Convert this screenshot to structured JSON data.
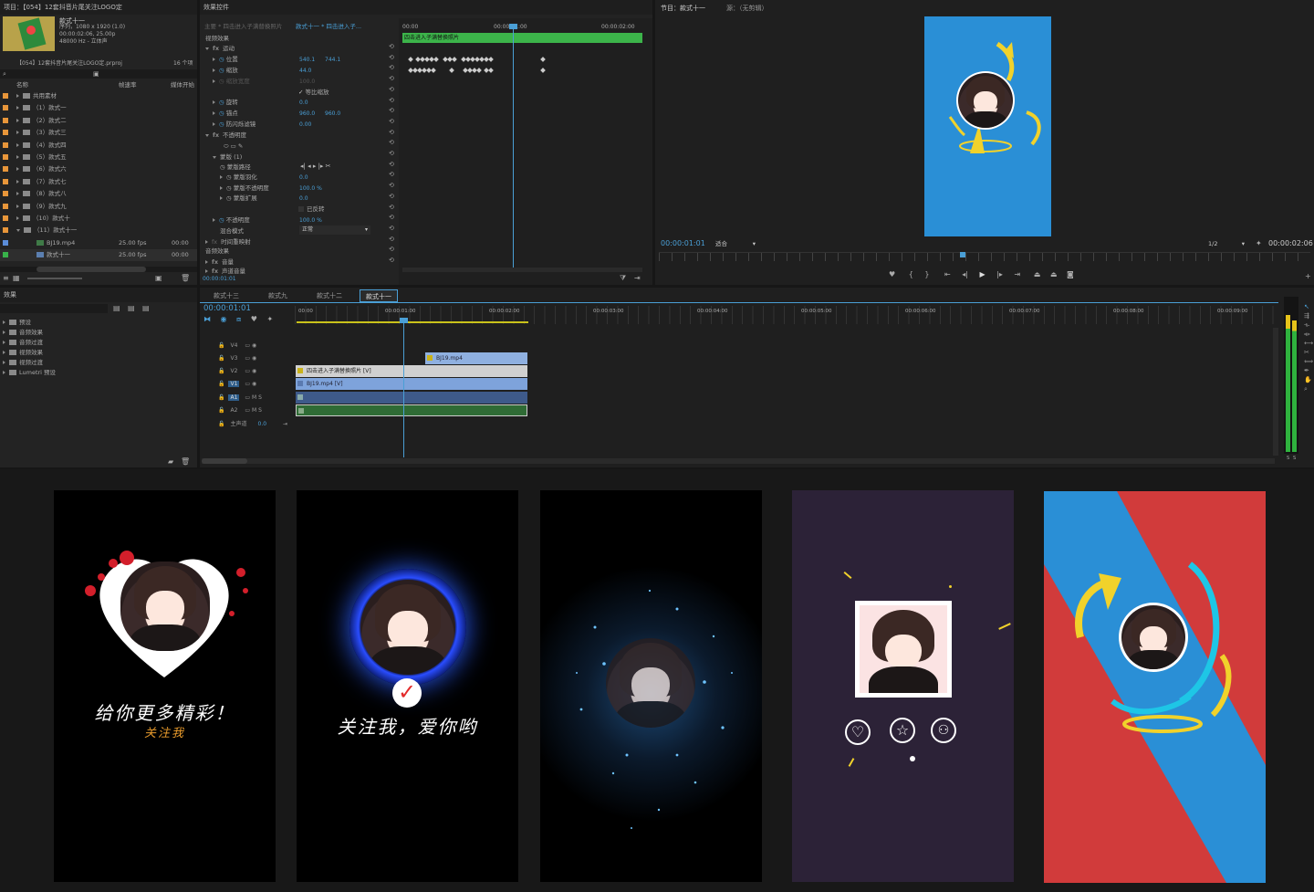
{
  "project": {
    "title": "项目：【054】12套抖音片尾关注LOGO定",
    "clip_name": "款式十一",
    "clip_info": [
      "序列，1080 x 1920 (1.0)",
      "00:00:02:06, 25.00p",
      "48000 Hz - 立体声"
    ],
    "file_name": "【054】12套抖音片尾关注LOGO定.prproj",
    "item_count": "16 个项",
    "columns": [
      "名称",
      "帧速率",
      "媒体开始"
    ],
    "items": [
      {
        "label": "共用素材",
        "type": "folder",
        "color": "#e8963a"
      },
      {
        "label": "（1）款式一",
        "type": "folder",
        "color": "#e8963a"
      },
      {
        "label": "（2）款式二",
        "type": "folder",
        "color": "#e8963a"
      },
      {
        "label": "（3）款式三",
        "type": "folder",
        "color": "#e8963a"
      },
      {
        "label": "（4）款式四",
        "type": "folder",
        "color": "#e8963a"
      },
      {
        "label": "（5）款式五",
        "type": "folder",
        "color": "#e8963a"
      },
      {
        "label": "（6）款式六",
        "type": "folder",
        "color": "#e8963a"
      },
      {
        "label": "（7）款式七",
        "type": "folder",
        "color": "#e8963a"
      },
      {
        "label": "（8）款式八",
        "type": "folder",
        "color": "#e8963a"
      },
      {
        "label": "（9）款式九",
        "type": "folder",
        "color": "#e8963a"
      },
      {
        "label": "（10）款式十",
        "type": "folder",
        "color": "#e8963a"
      },
      {
        "label": "（11）款式十一",
        "type": "folder",
        "color": "#e8963a"
      },
      {
        "label": "BJ19.mp4",
        "type": "clip",
        "color": "#5b8dd9",
        "fps": "25.00 fps",
        "start": "00:00"
      },
      {
        "label": "款式十一",
        "type": "sequence",
        "color": "#38b24a",
        "fps": "25.00 fps",
        "start": "00:00"
      }
    ]
  },
  "effects_panel": {
    "title": "效果",
    "items": [
      "预设",
      "音频效果",
      "音频过渡",
      "视频效果",
      "视频过渡",
      "Lumetri 预设"
    ]
  },
  "effect_controls": {
    "title": "效果控件",
    "source": "主要 * 四击进入子满替换照片",
    "sequence": "款式十一 * 四击进入子...",
    "video_effects_label": "视频效果",
    "audio_effects_label": "音频效果",
    "clip_bar_label": "四击进入子满替换照片",
    "ruler": [
      "00:00",
      "00:00:01:00",
      "00:00:02:00"
    ],
    "current": "00:00:01:01",
    "rows": [
      {
        "label": "运动",
        "kind": "group"
      },
      {
        "label": "位置",
        "v1": "540.1",
        "v2": "744.1",
        "kind": "prop"
      },
      {
        "label": "缩放",
        "v1": "44.0",
        "kind": "prop"
      },
      {
        "label": "缩放宽度",
        "v1": "100.0",
        "kind": "dim"
      },
      {
        "label": "等比缩放",
        "kind": "check"
      },
      {
        "label": "旋转",
        "v1": "0.0",
        "kind": "prop"
      },
      {
        "label": "锚点",
        "v1": "960.0",
        "v2": "960.0",
        "kind": "prop"
      },
      {
        "label": "防闪烁滤镜",
        "v1": "0.00",
        "kind": "prop"
      },
      {
        "label": "不透明度",
        "kind": "group"
      },
      {
        "label": "",
        "kind": "masktools"
      },
      {
        "label": "蒙版 (1)",
        "kind": "sub"
      },
      {
        "label": "蒙版路径",
        "kind": "maskpath"
      },
      {
        "label": "蒙版羽化",
        "v1": "0.0",
        "kind": "prop"
      },
      {
        "label": "蒙版不透明度",
        "v1": "100.0 %",
        "kind": "prop"
      },
      {
        "label": "蒙版扩展",
        "v1": "0.0",
        "kind": "prop"
      },
      {
        "label": "已反转",
        "kind": "check"
      },
      {
        "label": "不透明度",
        "v1": "100.0 %",
        "kind": "prop"
      },
      {
        "label": "混合模式",
        "v1": "正常",
        "kind": "select"
      },
      {
        "label": "时间重映射",
        "kind": "group"
      }
    ],
    "audio_rows": [
      "音量",
      "声道音量"
    ]
  },
  "program_monitor": {
    "title": "节目：款式十一",
    "source_tab": "源：（无剪辑）",
    "timecode": "00:00:01:01",
    "fit": "适合",
    "quality": "1/2",
    "duration": "00:00:02:06"
  },
  "timeline": {
    "tabs": [
      "款式十三",
      "款式九",
      "款式十二",
      "款式十一"
    ],
    "active_tab": "款式十一",
    "timecode": "00:00:01:01",
    "ruler": [
      "00:00",
      "00:00:01:00",
      "00:00:02:00",
      "00:00:03:00",
      "00:00:04:00",
      "00:00:05:00",
      "00:00:06:00",
      "00:00:07:00",
      "00:00:08:00",
      "00:00:09:00"
    ],
    "tracks": [
      "V4",
      "V3",
      "V2",
      "V1",
      "A1",
      "A2",
      "主声道"
    ],
    "master_value": "0.0",
    "clips": [
      {
        "label": "BJ19.mp4",
        "track": "V3",
        "color": "#8fb0e0"
      },
      {
        "label": "四击进入子满替换照片 [V]",
        "track": "V2",
        "color": "#d0d0d0"
      },
      {
        "label": "BJ19.mp4 [V]",
        "track": "V1",
        "color": "#7ea3db"
      },
      {
        "label": "",
        "track": "A1",
        "color": "#3e5a8a"
      },
      {
        "label": "",
        "track": "A2",
        "color": "#2f6b35"
      }
    ],
    "meter_labels": [
      "S",
      "S"
    ]
  },
  "previews": [
    {
      "caption": "给你更多精彩！",
      "sub": "关注我"
    },
    {
      "caption": "关注我，爱你哟",
      "sub": ""
    },
    {
      "caption": "",
      "sub": ""
    },
    {
      "caption": "",
      "sub": ""
    },
    {
      "caption": "",
      "sub": ""
    }
  ],
  "colors": {
    "accent": "#4a9fd6",
    "green": "#38b24a",
    "orange": "#e8963a",
    "purple": "#2c2237",
    "red": "#d13b3b",
    "sky": "#2a8fd6"
  }
}
